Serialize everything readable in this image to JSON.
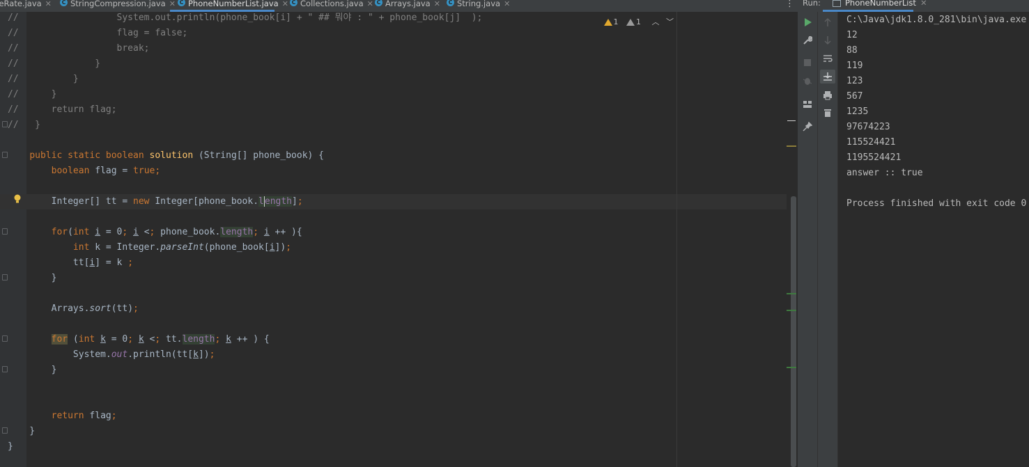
{
  "editor_tabs": [
    {
      "label": "reRate.java",
      "active": false
    },
    {
      "label": "StringCompression.java",
      "active": false
    },
    {
      "label": "PhoneNumberList.java",
      "active": true
    },
    {
      "label": "Collections.java",
      "active": false
    },
    {
      "label": "Arrays.java",
      "active": false
    },
    {
      "label": "String.java",
      "active": false
    }
  ],
  "inspection": {
    "warnings": "1",
    "weak_warnings": "1"
  },
  "code_lines": [
    "//                  System.out.println(phone_book[i] + \" ## 뭐야 : \" + phone_book[j]  );",
    "//                  flag = false;",
    "//                  break;",
    "//              }",
    "//          }",
    "//      }",
    "//      return flag;",
    "//   }",
    "",
    "    public static boolean solution (String[] phone_book) {",
    "        boolean flag = true;",
    "",
    "        Integer[] tt = new Integer[phone_book.length];",
    "",
    "        for(int i = 0; i < phone_book.length; i ++ ){",
    "            int k = Integer.parseInt(phone_book[i]);",
    "            tt[i] = k ;",
    "        }",
    "",
    "        Arrays.sort(tt);",
    "",
    "        for (int k = 0; k < tt.length; k ++ ) {",
    "            System.out.println(tt[k]);",
    "        }",
    "",
    "",
    "        return flag;",
    "    }",
    "}"
  ],
  "run": {
    "label": "Run:",
    "tab": "PhoneNumberList",
    "console_lines": [
      "C:\\Java\\jdk1.8.0_281\\bin\\java.exe",
      "12",
      "88",
      "119",
      "123",
      "567",
      "1235",
      "97674223",
      "115524421",
      "1195524421",
      "answer :: true",
      "",
      "Process finished with exit code 0"
    ]
  },
  "colors": {
    "keyword": "#cc7832",
    "method": "#ffc66d",
    "field": "#9876aa",
    "text": "#a9b7c6",
    "comment": "#808080",
    "accent": "#4a88c7"
  }
}
